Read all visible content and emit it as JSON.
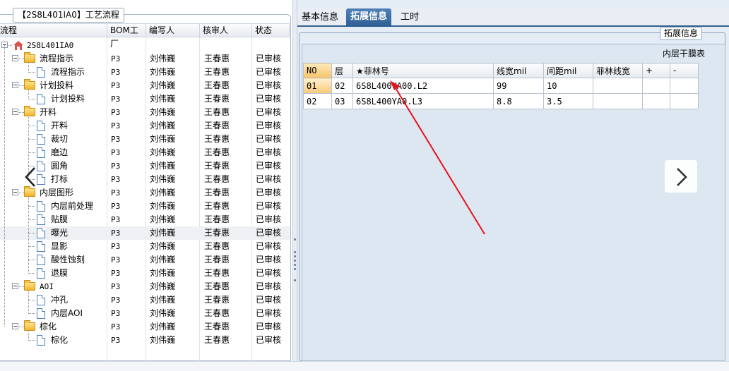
{
  "left_panel": {
    "title": "【2S8L401IA0】工艺流程",
    "columns": [
      "流程",
      "BOM工厂",
      "编写人",
      "核审人",
      "状态"
    ],
    "rows": [
      {
        "name": "2S8L401IA0",
        "level": 0,
        "kind": "root",
        "bom": "",
        "writer": "",
        "reviewer": "",
        "status": ""
      },
      {
        "name": "流程指示",
        "level": 1,
        "kind": "folder",
        "bom": "P3",
        "writer": "刘伟巍",
        "reviewer": "王春惠",
        "status": "已审核"
      },
      {
        "name": "流程指示",
        "level": 2,
        "kind": "doc",
        "bom": "P3",
        "writer": "刘伟巍",
        "reviewer": "王春惠",
        "status": "已审核"
      },
      {
        "name": "计划投料",
        "level": 1,
        "kind": "folder",
        "bom": "P3",
        "writer": "刘伟巍",
        "reviewer": "王春惠",
        "status": "已审核"
      },
      {
        "name": "计划投料",
        "level": 2,
        "kind": "doc",
        "bom": "P3",
        "writer": "刘伟巍",
        "reviewer": "王春惠",
        "status": "已审核"
      },
      {
        "name": "开料",
        "level": 1,
        "kind": "folder",
        "bom": "P3",
        "writer": "刘伟巍",
        "reviewer": "王春惠",
        "status": "已审核"
      },
      {
        "name": "开料",
        "level": 2,
        "kind": "doc",
        "bom": "P3",
        "writer": "刘伟巍",
        "reviewer": "王春惠",
        "status": "已审核"
      },
      {
        "name": "裁切",
        "level": 2,
        "kind": "doc",
        "bom": "P3",
        "writer": "刘伟巍",
        "reviewer": "王春惠",
        "status": "已审核"
      },
      {
        "name": "磨边",
        "level": 2,
        "kind": "doc",
        "bom": "P3",
        "writer": "刘伟巍",
        "reviewer": "王春惠",
        "status": "已审核"
      },
      {
        "name": "圆角",
        "level": 2,
        "kind": "doc",
        "bom": "P3",
        "writer": "刘伟巍",
        "reviewer": "王春惠",
        "status": "已审核"
      },
      {
        "name": "打标",
        "level": 2,
        "kind": "doc",
        "bom": "P3",
        "writer": "刘伟巍",
        "reviewer": "王春惠",
        "status": "已审核"
      },
      {
        "name": "内层图形",
        "level": 1,
        "kind": "folder",
        "bom": "P3",
        "writer": "刘伟巍",
        "reviewer": "王春惠",
        "status": "已审核"
      },
      {
        "name": "内层前处理",
        "level": 2,
        "kind": "doc",
        "bom": "P3",
        "writer": "刘伟巍",
        "reviewer": "王春惠",
        "status": "已审核"
      },
      {
        "name": "贴膜",
        "level": 2,
        "kind": "doc",
        "bom": "P3",
        "writer": "刘伟巍",
        "reviewer": "王春惠",
        "status": "已审核"
      },
      {
        "name": "曝光",
        "level": 2,
        "kind": "doc",
        "bom": "P3",
        "writer": "刘伟巍",
        "reviewer": "王春惠",
        "status": "已审核",
        "selected": true
      },
      {
        "name": "显影",
        "level": 2,
        "kind": "doc",
        "bom": "P3",
        "writer": "刘伟巍",
        "reviewer": "王春惠",
        "status": "已审核"
      },
      {
        "name": "酸性蚀刻",
        "level": 2,
        "kind": "doc",
        "bom": "P3",
        "writer": "刘伟巍",
        "reviewer": "王春惠",
        "status": "已审核"
      },
      {
        "name": "退膜",
        "level": 2,
        "kind": "doc",
        "bom": "P3",
        "writer": "刘伟巍",
        "reviewer": "王春惠",
        "status": "已审核"
      },
      {
        "name": "AOI",
        "level": 1,
        "kind": "folder",
        "bom": "P3",
        "writer": "刘伟巍",
        "reviewer": "王春惠",
        "status": "已审核"
      },
      {
        "name": "冲孔",
        "level": 2,
        "kind": "doc",
        "bom": "P3",
        "writer": "刘伟巍",
        "reviewer": "王春惠",
        "status": "已审核"
      },
      {
        "name": "内层AOI",
        "level": 2,
        "kind": "doc",
        "bom": "P3",
        "writer": "刘伟巍",
        "reviewer": "王春惠",
        "status": "已审核"
      },
      {
        "name": "棕化",
        "level": 1,
        "kind": "folder",
        "bom": "P3",
        "writer": "刘伟巍",
        "reviewer": "王春惠",
        "status": "已审核"
      },
      {
        "name": "棕化",
        "level": 2,
        "kind": "doc",
        "bom": "P3",
        "writer": "刘伟巍",
        "reviewer": "王春惠",
        "status": "已审核"
      }
    ]
  },
  "right_panel": {
    "tabs": [
      {
        "label": "基本信息",
        "active": false
      },
      {
        "label": "拓展信息",
        "active": true
      },
      {
        "label": "工时",
        "active": false
      }
    ],
    "group_label": "拓展信息",
    "table_title": "内层干膜表",
    "table": {
      "headers": [
        "NO",
        "层",
        "★菲林号",
        "线宽mil",
        "间距mil",
        "菲林线宽",
        "+",
        "-"
      ],
      "rows": [
        [
          "01",
          "02",
          "6S8L400YA00.L2",
          "99",
          "10",
          "",
          "",
          ""
        ],
        [
          "02",
          "03",
          "6S8L400YA0.L3",
          "8.8",
          "3.5",
          "",
          "",
          ""
        ]
      ]
    }
  },
  "annotation": {
    "arrow_color": "#e8121c"
  },
  "icons": {
    "root": "house-icon",
    "folder": "folder-icon",
    "doc": "document-icon",
    "prev": "chevron-left-icon",
    "next": "chevron-right-icon"
  }
}
